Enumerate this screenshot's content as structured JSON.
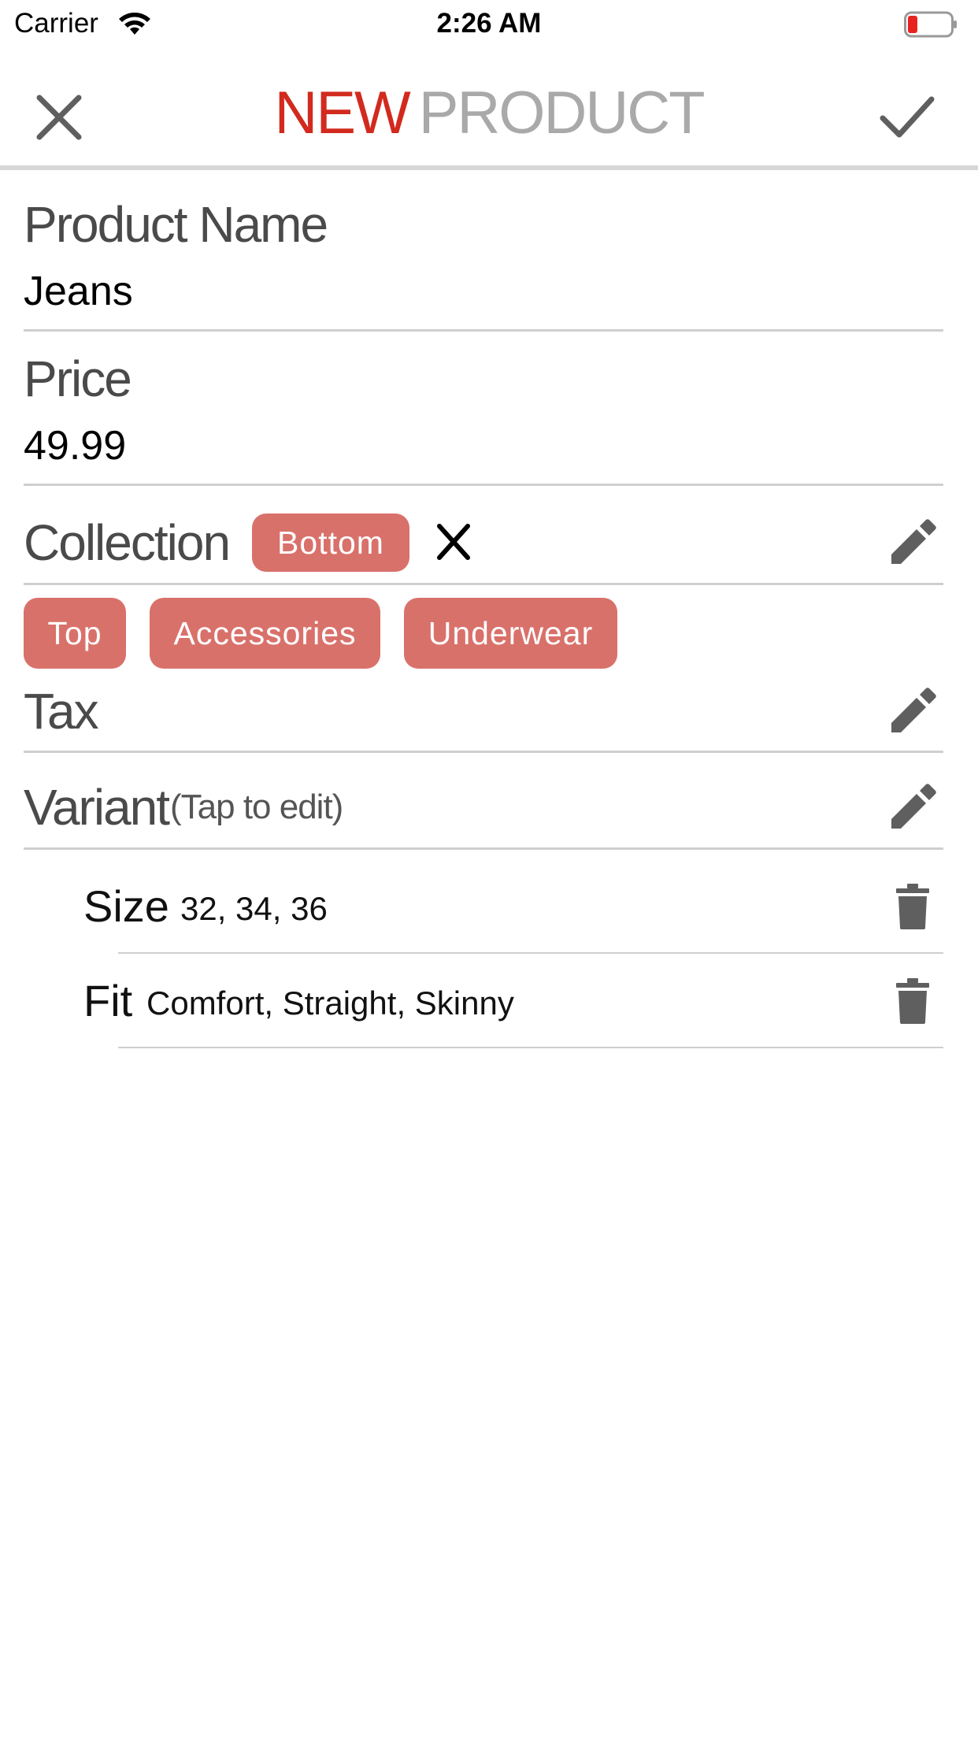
{
  "status_bar": {
    "carrier": "Carrier",
    "time": "2:26 AM"
  },
  "nav": {
    "title_part1": "NEW",
    "title_part2": "PRODUCT"
  },
  "form": {
    "product_name": {
      "label": "Product Name",
      "value": "Jeans"
    },
    "price": {
      "label": "Price",
      "value": "49.99"
    },
    "collection": {
      "label": "Collection",
      "selected": "Bottom",
      "options": [
        "Top",
        "Accessories",
        "Underwear"
      ]
    },
    "tax": {
      "label": "Tax"
    },
    "variant": {
      "label": "Variant",
      "hint": "(Tap to edit)",
      "items": [
        {
          "name": "Size",
          "values": "32, 34, 36"
        },
        {
          "name": "Fit",
          "values": "Comfort, Straight, Skinny"
        }
      ]
    }
  },
  "colors": {
    "accent_red": "#d22a1e",
    "chip": "#d9716b",
    "icon_gray": "#5f5f5f"
  }
}
